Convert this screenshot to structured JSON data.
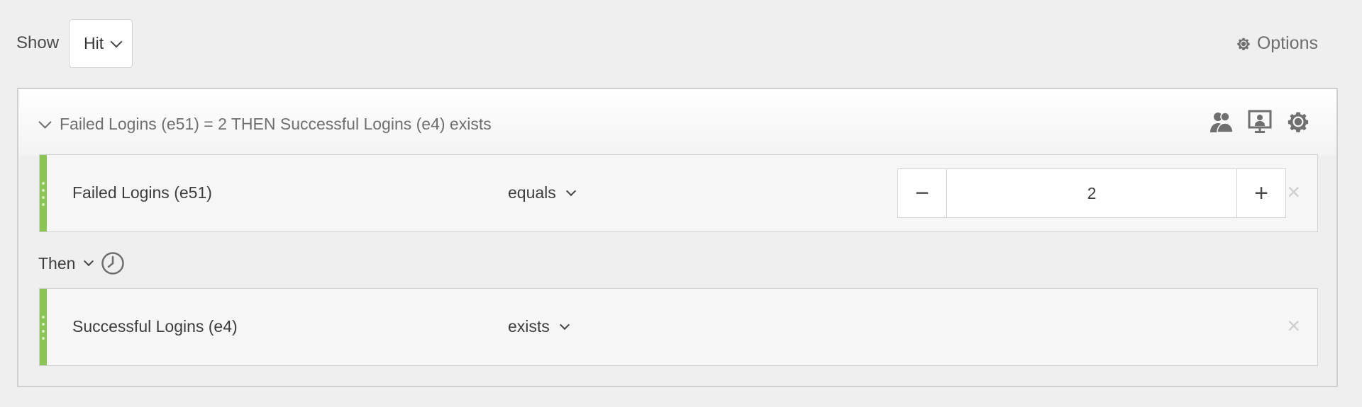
{
  "toolbar": {
    "show_label": "Show",
    "show_value": "Hit",
    "options_label": "Options"
  },
  "container": {
    "summary": "Failed Logins (e51) = 2 THEN Successful Logins (e4) exists",
    "icons": [
      "people-icon",
      "presentation-icon",
      "gear-icon"
    ]
  },
  "rules": [
    {
      "name": "Failed Logins (e51)",
      "operator": "equals",
      "value": "2",
      "minus": "−",
      "plus": "+",
      "remove": "×"
    },
    {
      "name": "Successful Logins (e4)",
      "operator": "exists",
      "remove": "×"
    }
  ],
  "then": {
    "label": "Then"
  },
  "colors": {
    "accent_bar": "#8ac452",
    "background": "#efefef",
    "border": "#d0d0d0"
  }
}
